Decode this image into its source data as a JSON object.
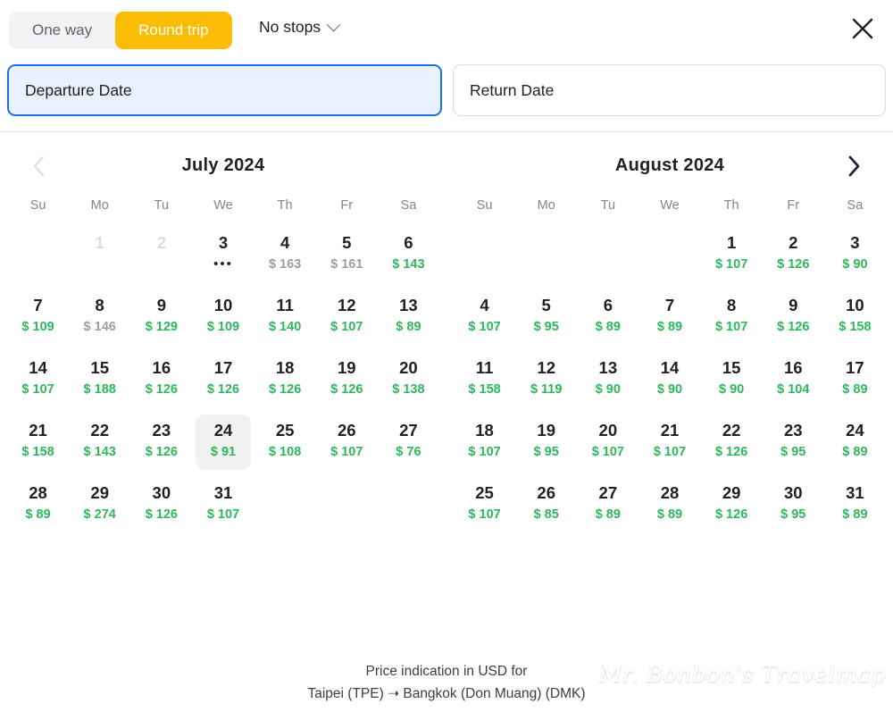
{
  "header": {
    "trip_tabs": [
      {
        "label": "One way",
        "active": false
      },
      {
        "label": "Round trip",
        "active": true
      }
    ],
    "stops_label": "No stops",
    "close_label": "×"
  },
  "fields": {
    "departure": {
      "label": "Departure Date",
      "focused": true
    },
    "return": {
      "label": "Return Date",
      "focused": false
    }
  },
  "nav": {
    "prev_label": "‹",
    "next_label": "›"
  },
  "colors": {
    "accent_yellow": "#fbbc04",
    "focus_blue": "#1a73e8",
    "focus_blue_bg": "#e8f1fd",
    "price_low_green": "#2eb85c",
    "price_high_gray": "#9aa0a6",
    "hover_gray": "#f1f1f1"
  },
  "dow_labels": [
    "Su",
    "Mo",
    "Tu",
    "We",
    "Th",
    "Fr",
    "Sa"
  ],
  "months": [
    {
      "title": "July  2024",
      "weeks": [
        [
          {
            "empty": true
          },
          {
            "day": "1",
            "disabled": true
          },
          {
            "day": "2",
            "disabled": true
          },
          {
            "day": "3",
            "price": "•••",
            "kind": "dots"
          },
          {
            "day": "4",
            "price": "$ 163",
            "kind": "high"
          },
          {
            "day": "5",
            "price": "$ 161",
            "kind": "high"
          },
          {
            "day": "6",
            "price": "$ 143",
            "kind": "low"
          }
        ],
        [
          {
            "day": "7",
            "price": "$ 109",
            "kind": "low"
          },
          {
            "day": "8",
            "price": "$ 146",
            "kind": "high"
          },
          {
            "day": "9",
            "price": "$ 129",
            "kind": "low"
          },
          {
            "day": "10",
            "price": "$ 109",
            "kind": "low"
          },
          {
            "day": "11",
            "price": "$ 140",
            "kind": "low"
          },
          {
            "day": "12",
            "price": "$ 107",
            "kind": "low"
          },
          {
            "day": "13",
            "price": "$ 89",
            "kind": "low"
          }
        ],
        [
          {
            "day": "14",
            "price": "$ 107",
            "kind": "low"
          },
          {
            "day": "15",
            "price": "$ 188",
            "kind": "low"
          },
          {
            "day": "16",
            "price": "$ 126",
            "kind": "low"
          },
          {
            "day": "17",
            "price": "$ 126",
            "kind": "low"
          },
          {
            "day": "18",
            "price": "$ 126",
            "kind": "low"
          },
          {
            "day": "19",
            "price": "$ 126",
            "kind": "low"
          },
          {
            "day": "20",
            "price": "$ 138",
            "kind": "low"
          }
        ],
        [
          {
            "day": "21",
            "price": "$ 158",
            "kind": "low"
          },
          {
            "day": "22",
            "price": "$ 143",
            "kind": "low"
          },
          {
            "day": "23",
            "price": "$ 126",
            "kind": "low"
          },
          {
            "day": "24",
            "price": "$ 91",
            "kind": "low",
            "hovered": true
          },
          {
            "day": "25",
            "price": "$ 108",
            "kind": "low"
          },
          {
            "day": "26",
            "price": "$ 107",
            "kind": "low"
          },
          {
            "day": "27",
            "price": "$ 76",
            "kind": "low"
          }
        ],
        [
          {
            "day": "28",
            "price": "$ 89",
            "kind": "low"
          },
          {
            "day": "29",
            "price": "$ 274",
            "kind": "low"
          },
          {
            "day": "30",
            "price": "$ 126",
            "kind": "low"
          },
          {
            "day": "31",
            "price": "$ 107",
            "kind": "low"
          },
          {
            "empty": true
          },
          {
            "empty": true
          },
          {
            "empty": true
          }
        ]
      ]
    },
    {
      "title": "August  2024",
      "weeks": [
        [
          {
            "empty": true
          },
          {
            "empty": true
          },
          {
            "empty": true
          },
          {
            "empty": true
          },
          {
            "day": "1",
            "price": "$ 107",
            "kind": "low"
          },
          {
            "day": "2",
            "price": "$ 126",
            "kind": "low"
          },
          {
            "day": "3",
            "price": "$ 90",
            "kind": "low"
          }
        ],
        [
          {
            "day": "4",
            "price": "$ 107",
            "kind": "low"
          },
          {
            "day": "5",
            "price": "$ 95",
            "kind": "low"
          },
          {
            "day": "6",
            "price": "$ 89",
            "kind": "low"
          },
          {
            "day": "7",
            "price": "$ 89",
            "kind": "low"
          },
          {
            "day": "8",
            "price": "$ 107",
            "kind": "low"
          },
          {
            "day": "9",
            "price": "$ 126",
            "kind": "low"
          },
          {
            "day": "10",
            "price": "$ 158",
            "kind": "low"
          }
        ],
        [
          {
            "day": "11",
            "price": "$ 158",
            "kind": "low"
          },
          {
            "day": "12",
            "price": "$ 119",
            "kind": "low"
          },
          {
            "day": "13",
            "price": "$ 90",
            "kind": "low"
          },
          {
            "day": "14",
            "price": "$ 90",
            "kind": "low"
          },
          {
            "day": "15",
            "price": "$ 90",
            "kind": "low"
          },
          {
            "day": "16",
            "price": "$ 104",
            "kind": "low"
          },
          {
            "day": "17",
            "price": "$ 89",
            "kind": "low"
          }
        ],
        [
          {
            "day": "18",
            "price": "$ 107",
            "kind": "low"
          },
          {
            "day": "19",
            "price": "$ 95",
            "kind": "low"
          },
          {
            "day": "20",
            "price": "$ 107",
            "kind": "low"
          },
          {
            "day": "21",
            "price": "$ 107",
            "kind": "low"
          },
          {
            "day": "22",
            "price": "$ 126",
            "kind": "low"
          },
          {
            "day": "23",
            "price": "$ 95",
            "kind": "low"
          },
          {
            "day": "24",
            "price": "$ 89",
            "kind": "low"
          }
        ],
        [
          {
            "day": "25",
            "price": "$ 107",
            "kind": "low"
          },
          {
            "day": "26",
            "price": "$ 85",
            "kind": "low"
          },
          {
            "day": "27",
            "price": "$ 89",
            "kind": "low"
          },
          {
            "day": "28",
            "price": "$ 89",
            "kind": "low"
          },
          {
            "day": "29",
            "price": "$ 126",
            "kind": "low"
          },
          {
            "day": "30",
            "price": "$ 95",
            "kind": "low"
          },
          {
            "day": "31",
            "price": "$ 89",
            "kind": "low"
          }
        ]
      ]
    }
  ],
  "footer": {
    "line1": "Price indication in USD for",
    "line2": "Taipei (TPE) ➝ Bangkok (Don Muang) (DMK)",
    "watermark": "Mr. Bonbon's Travelmap"
  }
}
